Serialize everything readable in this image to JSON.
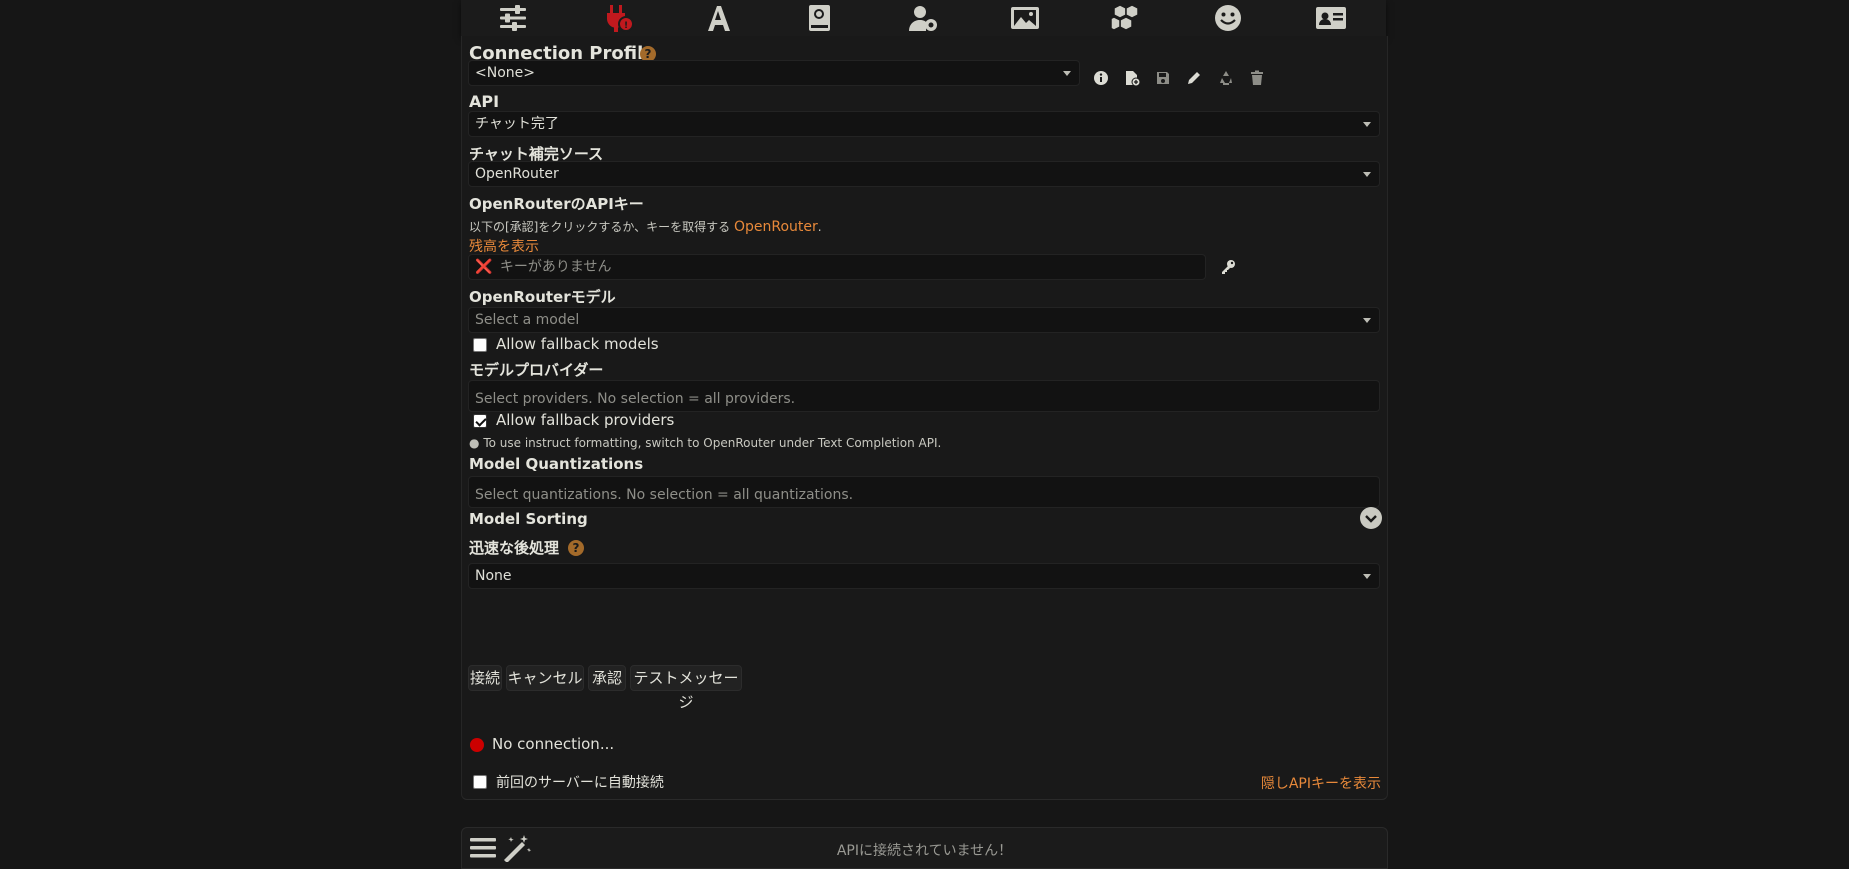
{
  "topnav": {
    "icons": [
      "sliders-icon",
      "plug-icon",
      "font-icon",
      "book-icon",
      "user-cog-icon",
      "image-icon",
      "cubes-icon",
      "smile-icon",
      "id-card-icon"
    ]
  },
  "connection_profile": {
    "label": "Connection Profile",
    "help": "?",
    "selected": "<None>"
  },
  "api": {
    "label": "API",
    "selected": "チャット完了"
  },
  "source": {
    "label": "チャット補完ソース",
    "selected": "OpenRouter"
  },
  "apikey": {
    "label": "OpenRouterのAPIキー",
    "hint_prefix": "以下の[承認]をクリックするか、キーを取得する",
    "hint_link": "OpenRouter",
    "hint_suffix": ".",
    "balance_link": "残高を表示",
    "x_mark": "❌",
    "placeholder": "キーがありません"
  },
  "model": {
    "label": "OpenRouterモデル",
    "placeholder": "Select a model",
    "fallback_label": "Allow fallback models",
    "fallback_checked": false
  },
  "providers": {
    "label": "モデルプロバイダー",
    "placeholder": "Select providers. No selection = all providers.",
    "fallback_label": "Allow fallback providers",
    "fallback_checked": true,
    "tip": "To use instruct formatting, switch to OpenRouter under Text Completion API."
  },
  "quantizations": {
    "label": "Model Quantizations",
    "placeholder": "Select quantizations. No selection = all quantizations."
  },
  "sorting": {
    "label": "Model Sorting"
  },
  "postprocess": {
    "label": "迅速な後処理",
    "help": "?",
    "selected": "None"
  },
  "buttons": {
    "connect": "接続",
    "cancel": "キャンセル",
    "authorize": "承認",
    "test": "テストメッセージ"
  },
  "status": {
    "text": "No connection...",
    "color": "#cc0000"
  },
  "autoconnect": {
    "label": "前回のサーバーに自動接続",
    "checked": false
  },
  "hidden_keys_link": "隠しAPIキーを表示",
  "chat_input": {
    "placeholder": "APIに接続されていません！"
  },
  "colors": {
    "accent": "#e8893a",
    "plug_active": "#c0191e"
  }
}
